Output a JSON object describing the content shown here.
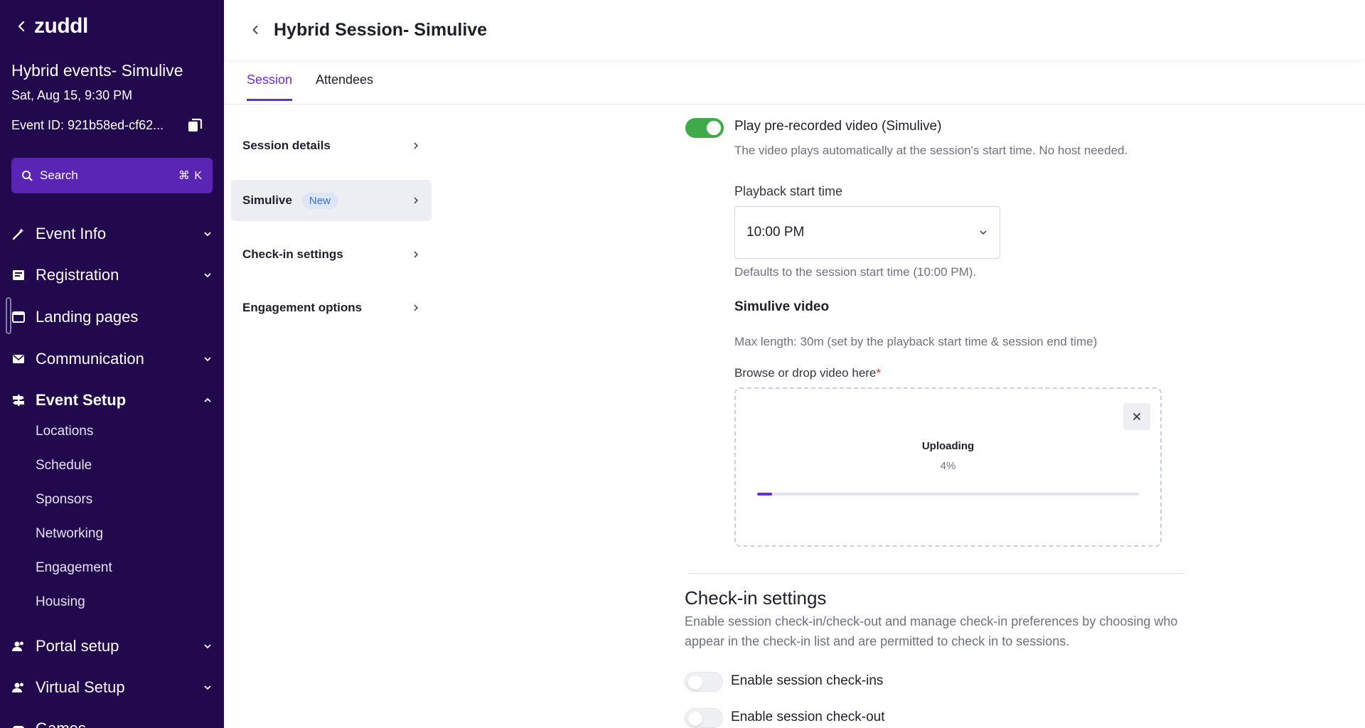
{
  "sidebar": {
    "logo": "zuddl",
    "event_title": "Hybrid events- Simulive",
    "event_date": "Sat, Aug 15, 9:30 PM",
    "event_id": "Event ID: 921b58ed-cf62...",
    "search_label": "Search",
    "search_shortcut": "⌘ K",
    "nav": [
      {
        "label": "Event Info",
        "icon": "magic-wand-icon"
      },
      {
        "label": "Registration",
        "icon": "form-icon"
      },
      {
        "label": "Landing pages",
        "icon": "browser-icon"
      },
      {
        "label": "Communication",
        "icon": "mail-icon"
      },
      {
        "label": "Event Setup",
        "icon": "signpost-icon"
      },
      {
        "label": "Portal setup",
        "icon": "people-icon"
      },
      {
        "label": "Virtual Setup",
        "icon": "people-icon"
      },
      {
        "label": "Games",
        "icon": "game-icon"
      }
    ],
    "event_setup_items": [
      "Locations",
      "Schedule",
      "Sponsors",
      "Networking",
      "Engagement",
      "Housing"
    ]
  },
  "header": {
    "title": "Hybrid Session- Simulive"
  },
  "tabs": [
    {
      "label": "Session",
      "active": true
    },
    {
      "label": "Attendees",
      "active": false
    }
  ],
  "inner_nav": [
    {
      "label": "Session details"
    },
    {
      "label": "Simulive",
      "badge": "New",
      "selected": true
    },
    {
      "label": "Check-in settings"
    },
    {
      "label": "Engagement options"
    }
  ],
  "simulive": {
    "toggle_label": "Play pre-recorded video (Simulive)",
    "toggle_on": true,
    "toggle_help": "The video plays automatically at the session's start time. No host needed.",
    "playback_label": "Playback start time",
    "playback_value": "10:00 PM",
    "playback_help": "Defaults to the session start time (10:00 PM).",
    "video_heading": "Simulive video",
    "video_help": "Max length: 30m (set by the playback start time & session end time)",
    "dropzone_label": "Browse or drop video here",
    "required_mark": "*",
    "upload_status": "Uploading",
    "upload_percent": "4%",
    "upload_progress": 0.04
  },
  "checkin": {
    "heading": "Check-in settings",
    "description": "Enable session check-in/check-out and manage check-in preferences by choosing who appear in the check-in list and are permitted to check in to sessions.",
    "checkins_label": "Enable session check-ins",
    "checkins_on": false,
    "checkout_label": "Enable session check-out",
    "checkout_on": false
  },
  "colors": {
    "sidebar_bg": "#22084d",
    "accent": "#6b2bd9",
    "toggle_on": "#3eaa4a"
  }
}
